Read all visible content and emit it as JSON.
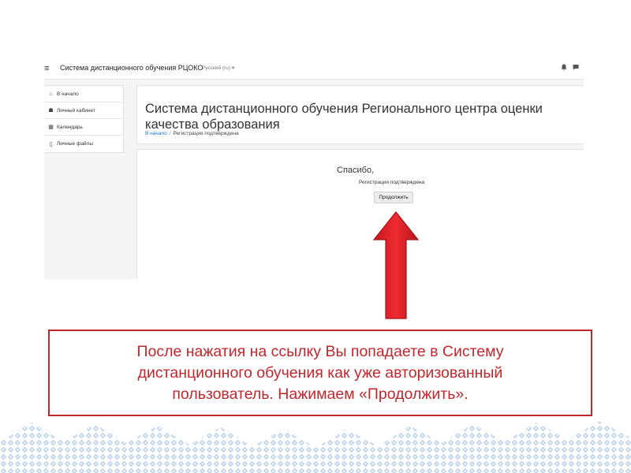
{
  "navbar": {
    "menu_icon": "≡",
    "site_name": "Система дистанционного обучения РЦОКО",
    "language": "Русский (ru) ▾",
    "bell_icon": "🔔",
    "chat_icon": "💬"
  },
  "sidebar": {
    "items": [
      {
        "icon": "⌂",
        "icon_name": "home-icon",
        "label": "В начало"
      },
      {
        "icon": "☗",
        "icon_name": "dashboard-icon",
        "label": "Личный кабинет"
      },
      {
        "icon": "▦",
        "icon_name": "calendar-icon",
        "label": "Календарь"
      },
      {
        "icon": "▯",
        "icon_name": "file-icon",
        "label": "Личные файлы"
      }
    ]
  },
  "header": {
    "title": "Система дистанционного обучения Регионального центра оценки качества образования",
    "breadcrumb": {
      "home": "В начало",
      "separator": "/",
      "current": "Регистрация подтверждена"
    }
  },
  "main": {
    "thanks": "Спасибо,",
    "confirmed": "Регистрация подтверждена",
    "continue_button": "Продолжить"
  },
  "caption": {
    "line1": "После нажатия на ссылку Вы попадаете в Систему",
    "line2": "дистанционного обучения как уже авторизованный",
    "line3": "пользователь. Нажимаем «Продолжить»."
  },
  "colors": {
    "accent_red": "#c0272d",
    "arrow_red": "#e21f26",
    "link_blue": "#1177d1",
    "ornament_blue": "#bcd3ea"
  }
}
